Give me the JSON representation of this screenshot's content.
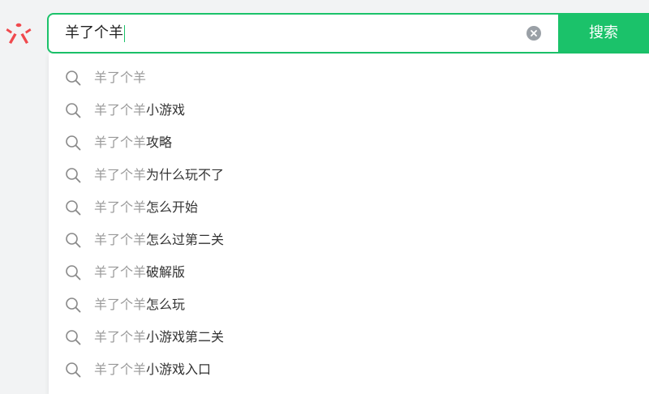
{
  "search": {
    "query": "羊了个羊",
    "button_label": "搜索"
  },
  "suggestions": [
    {
      "prefix": "羊了个羊",
      "suffix": ""
    },
    {
      "prefix": "羊了个羊",
      "suffix": "小游戏"
    },
    {
      "prefix": "羊了个羊",
      "suffix": "攻略"
    },
    {
      "prefix": "羊了个羊",
      "suffix": "为什么玩不了"
    },
    {
      "prefix": "羊了个羊",
      "suffix": "怎么开始"
    },
    {
      "prefix": "羊了个羊",
      "suffix": "怎么过第二关"
    },
    {
      "prefix": "羊了个羊",
      "suffix": "破解版"
    },
    {
      "prefix": "羊了个羊",
      "suffix": "怎么玩"
    },
    {
      "prefix": "羊了个羊",
      "suffix": "小游戏第二关"
    },
    {
      "prefix": "羊了个羊",
      "suffix": "小游戏入口"
    }
  ],
  "icons": {
    "logo": "asterisk-logo-icon",
    "clear": "clear-circle-icon",
    "suggestion": "search-icon"
  },
  "colors": {
    "accent": "#1bc26a",
    "logo": "#f0494d",
    "prefix_text": "#999999",
    "suffix_text": "#333333",
    "clear_icon": "#9aa0a6"
  }
}
